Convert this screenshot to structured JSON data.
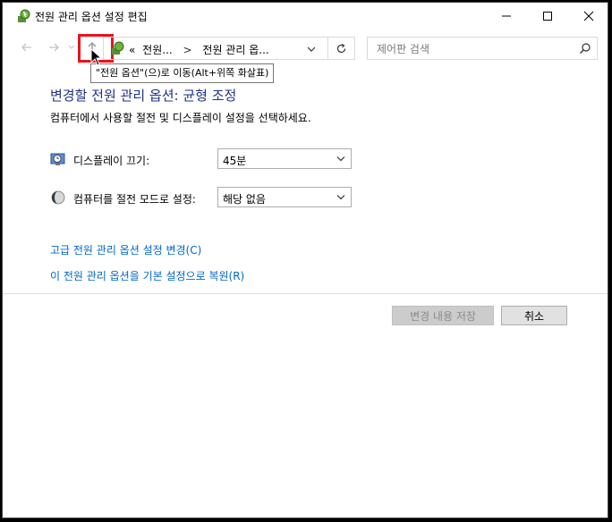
{
  "window": {
    "title": "전원 관리 옵션 설정 편집"
  },
  "nav": {
    "breadcrumb": [
      "«",
      "전원...",
      ">",
      "전원 관리 옵..."
    ],
    "tooltip": "\"전원 옵션\"(으)로 이동(Alt+위쪽 화살표)"
  },
  "search": {
    "placeholder": "제어판 검색"
  },
  "content": {
    "title": "변경할 전원 관리 옵션: 균형 조정",
    "description": "컴퓨터에서 사용할 절전 및 디스플레이 설정을 선택하세요.",
    "settings": [
      {
        "label": "디스플레이 끄기:",
        "value": "45분",
        "icon": "monitor-clock-icon"
      },
      {
        "label": "컴퓨터를 절전 모드로 설정:",
        "value": "해당 없음",
        "icon": "moon-icon"
      }
    ],
    "links": {
      "advanced": "고급 전원 관리 옵션 설정 변경(C)",
      "restore": "이 전원 관리 옵션을 기본 설정으로 복원(R)"
    }
  },
  "buttons": {
    "save": "변경 내용 저장",
    "cancel": "취소"
  },
  "colors": {
    "title_blue": "#1e3287",
    "link_blue": "#0066cc",
    "highlight_red": "#e8141c"
  }
}
